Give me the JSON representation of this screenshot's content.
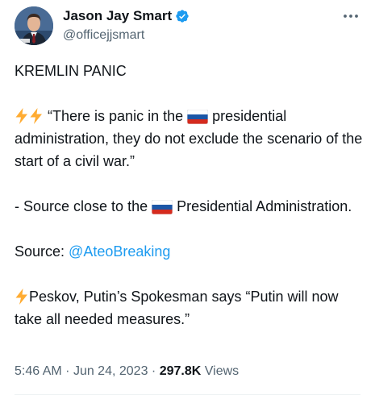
{
  "author": {
    "display_name": "Jason Jay Smart",
    "handle": "@officejjsmart",
    "verified": true,
    "avatar_icon": "avatar-photo"
  },
  "more_icon": "more-options-icon",
  "tweet": {
    "headline": "KREMLIN PANIC",
    "quote_prefix": "“There is panic in the",
    "quote_rest": "presidential administration, they do not exclude the scenario of the start of a civil war.”",
    "source_close_prefix": "- Source close to the",
    "source_close_suffix": "Presidential Administration.",
    "source_label": "Source: ",
    "source_link": "@AteoBreaking",
    "peskov_text": "Peskov, Putin’s Spokesman says “Putin will now take all needed measures.”"
  },
  "meta": {
    "time": "5:46 AM",
    "date": "Jun 24, 2023",
    "separator": "·",
    "views_count": "297.8K",
    "views_label": "Views"
  },
  "colors": {
    "text": "#0f1419",
    "secondary": "#536471",
    "link": "#1d9bf0",
    "verified": "#1d9bf0",
    "lightning": "#ffac33"
  }
}
